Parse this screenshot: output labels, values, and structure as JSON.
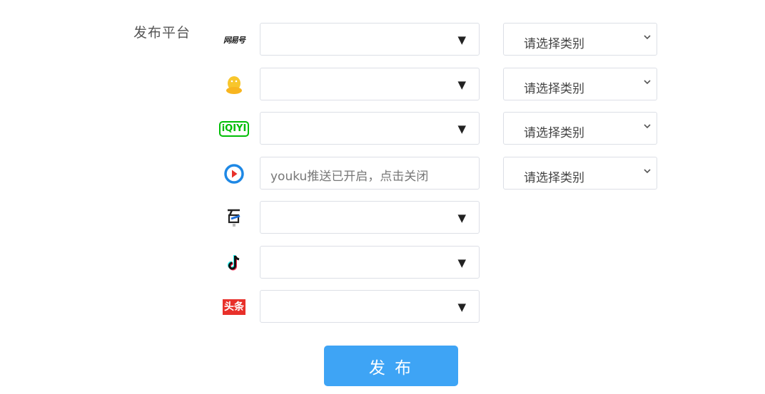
{
  "form": {
    "label": "发布平台"
  },
  "platforms": [
    {
      "icon": "netease-logo-icon",
      "logo_text": "网易号",
      "value": "",
      "category": "请选择类别",
      "has_category": true
    },
    {
      "icon": "qq-penguin-icon",
      "value": "",
      "category": "请选择类别",
      "has_category": true
    },
    {
      "icon": "iqiyi-logo-icon",
      "logo_text": "iQIYI",
      "value": "",
      "category": "请选择类别",
      "has_category": true
    },
    {
      "icon": "youku-logo-icon",
      "value": "youku推送已开启，点击关闭",
      "category": "请选择类别",
      "has_category": true
    },
    {
      "icon": "baijiahao-logo-icon",
      "value": "",
      "has_category": false
    },
    {
      "icon": "douyin-logo-icon",
      "value": "",
      "has_category": false
    },
    {
      "icon": "toutiao-logo-icon",
      "logo_text": "头条",
      "value": "",
      "has_category": false
    }
  ],
  "dropdown_caret": "▼",
  "publish_button": {
    "label": "发 布"
  },
  "colors": {
    "accent": "#3ea4f5",
    "border": "#dcdfe6",
    "toutiao_red": "#e8302a",
    "iqiyi_green": "#00be06",
    "youku_blue": "#1e88e5"
  }
}
